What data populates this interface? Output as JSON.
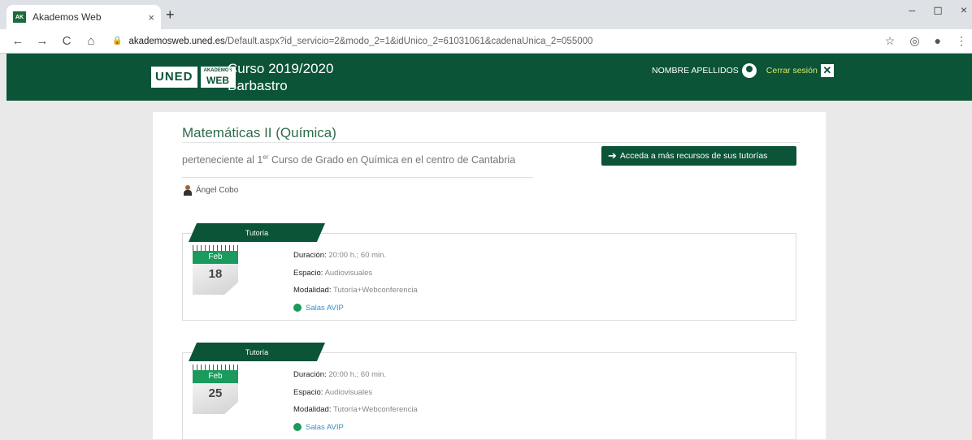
{
  "browser": {
    "tab_title": "Akademos Web",
    "favicon_text": "AK",
    "tab_close": "×",
    "new_tab": "+",
    "url_host": "akademosweb.uned.es",
    "url_path": "/Default.aspx?id_servicio=2&modo_2=1&idUnico_2=61031061&cadenaUnica_2=055000",
    "nav_back": "←",
    "nav_forward": "→",
    "nav_reload": "C",
    "nav_home": "⌂",
    "addr_icons": [
      "☆",
      "◎",
      "●",
      "⋮"
    ],
    "win_controls": [
      "–",
      "◻",
      "×"
    ]
  },
  "header": {
    "logo_uned": "UNED",
    "logo_ak_small": "AKADEMOS",
    "logo_ak_big": "WEB",
    "course_year": "Curso 2019/2020",
    "center": "Barbastro",
    "user_name": "NOMBRE APELLIDOS",
    "logout_label": "Cerrar sesión",
    "logout_icon": "✕"
  },
  "subject": {
    "title": "Matemáticas II (Química)",
    "belongs_pre": "perteneciente al 1",
    "belongs_sup": "er",
    "belongs_post": " Curso de Grado en Química en el centro de Cantabria",
    "teacher": "Ángel Cobo",
    "resources_button": "Acceda a más recursos de sus tutorías",
    "arrow": "➔"
  },
  "tutorias": [
    {
      "label": "Tutoría",
      "month": "Feb",
      "day": "18",
      "duracion_label": "Duración:",
      "duracion": "20:00 h.; 60 min.",
      "espacio_label": "Espacio:",
      "espacio": "Audiovisuales",
      "modalidad_label": "Modalidad:",
      "modalidad": "Tutoría+Webconferencia",
      "salas": "Salas AVIP"
    },
    {
      "label": "Tutoría",
      "month": "Feb",
      "day": "25",
      "duracion_label": "Duración:",
      "duracion": "20:00 h.; 60 min.",
      "espacio_label": "Espacio:",
      "espacio": "Audiovisuales",
      "modalidad_label": "Modalidad:",
      "modalidad": "Tutoría+Webconferencia",
      "salas": "Salas AVIP"
    }
  ],
  "colors": {
    "brand_green": "#0b5437",
    "calendar_green": "#1a9a5c",
    "link_blue": "#3a8fc7",
    "logout_yellow": "#d8e66a"
  }
}
